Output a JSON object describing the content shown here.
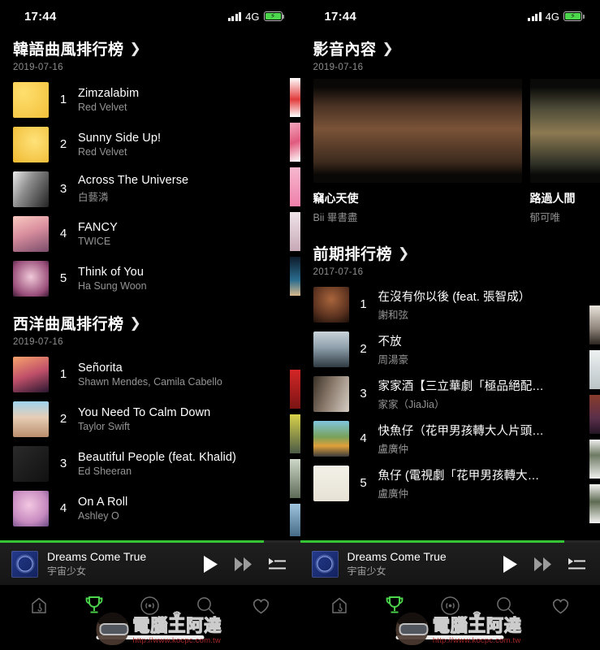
{
  "status_bar": {
    "time": "17:44",
    "network": "4G",
    "battery_icon": "battery-charging-icon",
    "signal_icon": "signal-bars-icon"
  },
  "left_phone": {
    "sections": [
      {
        "title": "韓語曲風排行榜",
        "chevron": "chevron-right-icon",
        "date": "2019-07-16",
        "songs": [
          {
            "rank": "1",
            "title": "Zimzalabim",
            "artist": "Red Velvet"
          },
          {
            "rank": "2",
            "title": "Sunny Side Up!",
            "artist": "Red Velvet"
          },
          {
            "rank": "3",
            "title": "Across The Universe",
            "artist": "白藝潾"
          },
          {
            "rank": "4",
            "title": "FANCY",
            "artist": "TWICE"
          },
          {
            "rank": "5",
            "title": "Think of You",
            "artist": "Ha Sung Woon"
          }
        ]
      },
      {
        "title": "西洋曲風排行榜",
        "chevron": "chevron-right-icon",
        "date": "2019-07-16",
        "songs": [
          {
            "rank": "1",
            "title": "Señorita",
            "artist": "Shawn Mendes, Camila Cabello"
          },
          {
            "rank": "2",
            "title": "You Need To Calm Down",
            "artist": "Taylor Swift"
          },
          {
            "rank": "3",
            "title": "Beautiful People (feat. Khalid)",
            "artist": "Ed Sheeran"
          },
          {
            "rank": "4",
            "title": "On A Roll",
            "artist": "Ashley O"
          }
        ]
      }
    ]
  },
  "right_phone": {
    "video_section": {
      "title": "影音內容",
      "chevron": "chevron-right-icon",
      "date": "2019-07-16",
      "videos": [
        {
          "title": "竊心天使",
          "artist": "Bii 畢書盡"
        },
        {
          "title": "路過人間",
          "artist": "郁可唯"
        }
      ]
    },
    "chart_section": {
      "title": "前期排行榜",
      "chevron": "chevron-right-icon",
      "date": "2017-07-16",
      "songs": [
        {
          "rank": "1",
          "title": "在沒有你以後 (feat. 張智成）",
          "artist": "謝和弦"
        },
        {
          "rank": "2",
          "title": "不放",
          "artist": "周湯豪"
        },
        {
          "rank": "3",
          "title": "家家酒【三立華劇「極品絕配…",
          "artist": "家家（JiaJia）"
        },
        {
          "rank": "4",
          "title": "快魚仔（花甲男孩轉大人片頭…",
          "artist": "盧廣仲"
        },
        {
          "rank": "5",
          "title": "魚仔 (電視劇「花甲男孩轉大…",
          "artist": "盧廣仲"
        }
      ]
    }
  },
  "player": {
    "title": "Dreams Come True",
    "artist": "宇宙少女",
    "progress_percent": 88,
    "progress_color": "#35c435",
    "play_icon": "play-icon",
    "next_icon": "fast-forward-icon",
    "queue_icon": "playlist-queue-icon",
    "artwork_icon": "album-artwork"
  },
  "tab_bar": {
    "active_color": "#4cd64c",
    "inactive_color": "#6e6e6e",
    "tabs": [
      {
        "name": "home-music-icon",
        "active": false
      },
      {
        "name": "trophy-chart-icon",
        "active": true
      },
      {
        "name": "radio-broadcast-icon",
        "active": false
      },
      {
        "name": "search-icon",
        "active": false
      },
      {
        "name": "favorite-heart-icon",
        "active": false
      }
    ]
  },
  "watermark": {
    "text": "電腦王阿達",
    "url": "http://www.kocpc.com.tw",
    "crown": "♕"
  }
}
